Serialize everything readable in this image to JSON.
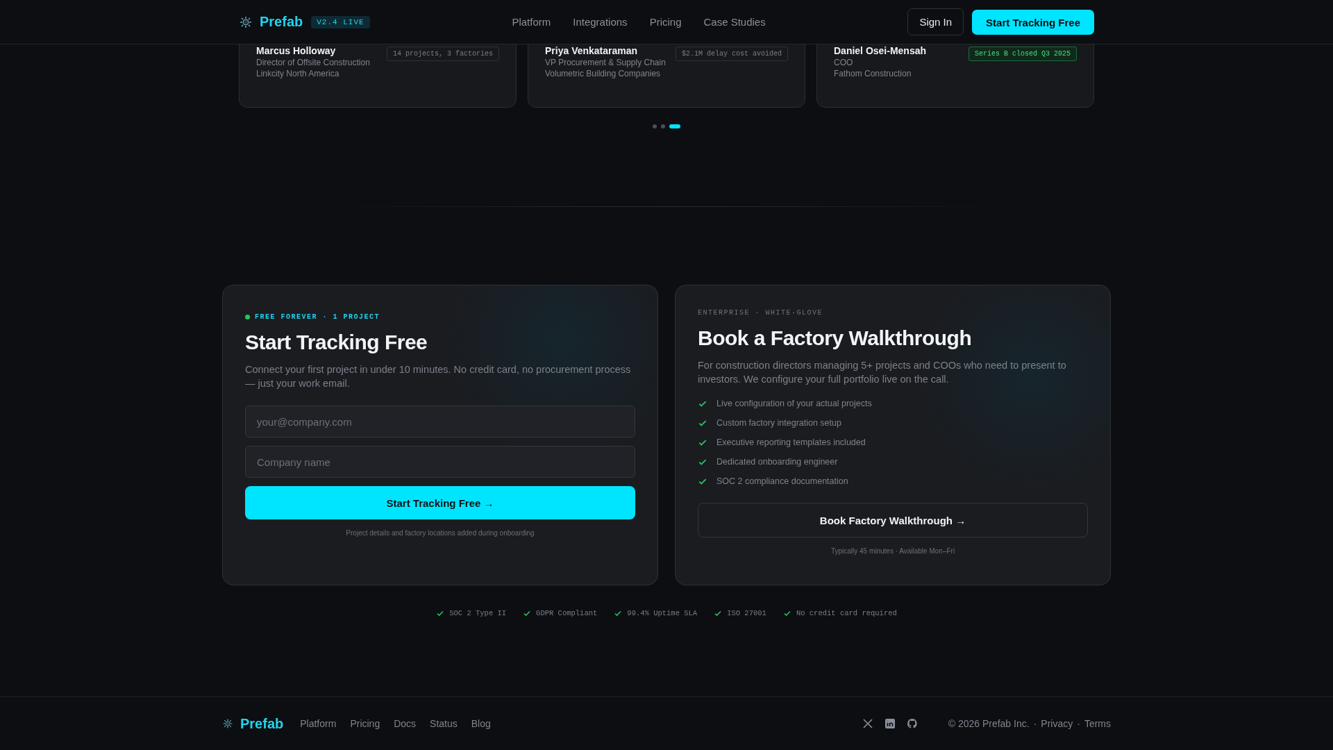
{
  "header": {
    "logo_text": "Prefab",
    "version_badge": "V2.4 LIVE",
    "nav": [
      {
        "label": "Platform"
      },
      {
        "label": "Integrations"
      },
      {
        "label": "Pricing"
      },
      {
        "label": "Case Studies"
      }
    ],
    "sign_in": "Sign In",
    "cta": "Start Tracking Free"
  },
  "testimonials": [
    {
      "name": "Marcus Holloway",
      "role": "Director of Offsite Construction",
      "company": "Linkcity North America",
      "metric": "14 projects, 3 factories",
      "highlighted": false
    },
    {
      "name": "Priya Venkataraman",
      "role": "VP Procurement & Supply Chain",
      "company": "Volumetric Building Companies",
      "metric": "$2.1M delay cost avoided",
      "highlighted": false
    },
    {
      "name": "Daniel Osei-Mensah",
      "role": "COO",
      "company": "Fathom Construction",
      "metric": "Series B closed Q3 2025",
      "highlighted": true
    }
  ],
  "carousel_dots": [
    {
      "selected": false
    },
    {
      "selected": false
    },
    {
      "selected": true
    }
  ],
  "free_plan": {
    "tag": "FREE FOREVER · 1 PROJECT",
    "title": "Start Tracking Free",
    "description": "Connect your first project in under 10 minutes. No credit card, no procurement process — just your work email.",
    "email_placeholder": "your@company.com",
    "company_placeholder": "Company name",
    "button": "Start Tracking Free →",
    "note": "Project details and factory locations added during onboarding"
  },
  "enterprise": {
    "tag": "ENTERPRISE · WHITE-GLOVE",
    "title": "Book a Factory Walkthrough",
    "description": "For construction directors managing 5+ projects and COOs who need to present to investors. We configure your full portfolio live on the call.",
    "features": [
      "Live configuration of your actual projects",
      "Custom factory integration setup",
      "Executive reporting templates included",
      "Dedicated onboarding engineer",
      "SOC 2 compliance documentation"
    ],
    "button": "Book Factory Walkthrough →",
    "note": "Typically 45 minutes · Available Mon–Fri"
  },
  "trust": [
    "SOC 2 Type II",
    "GDPR Compliant",
    "99.4% Uptime SLA",
    "ISO 27001",
    "No credit card required"
  ],
  "footer": {
    "logo_text": "Prefab",
    "links": [
      "Platform",
      "Pricing",
      "Docs",
      "Status",
      "Blog"
    ],
    "copyright": "© 2026 Prefab Inc.",
    "separator_1": "·",
    "privacy": "Privacy",
    "separator_2": "·",
    "terms": "Terms"
  }
}
